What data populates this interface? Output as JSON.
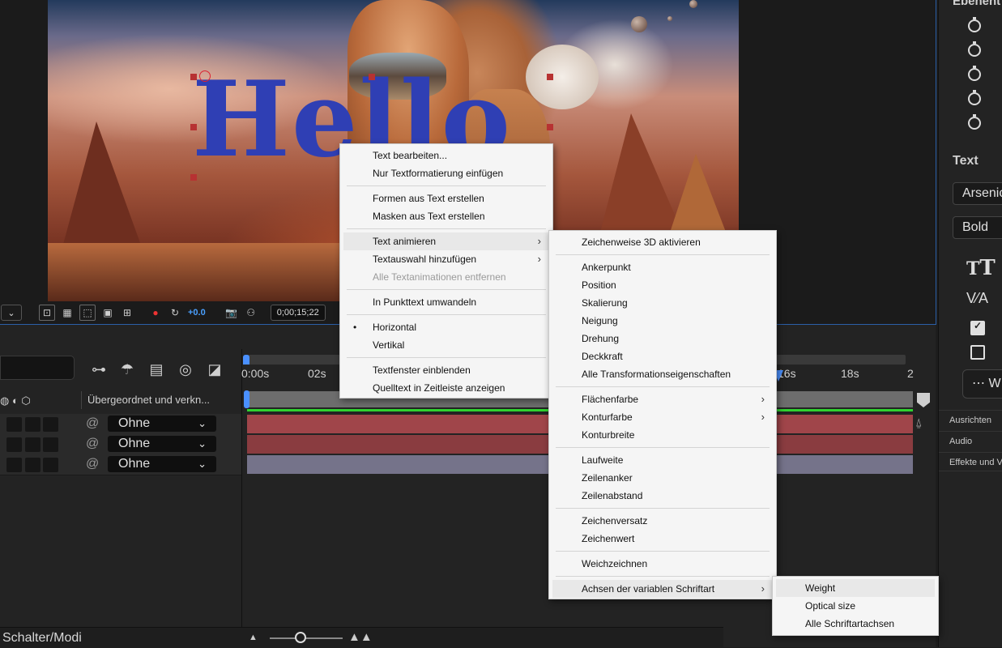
{
  "overlay_text": "Hello",
  "comp_toolbar": {
    "resolution_chevron": "⌄",
    "exposure": "+0.0",
    "timecode": "0;00;15;22"
  },
  "right_panel": {
    "top_label": "Ebenent",
    "text_section": "Text",
    "font_family": "Arsenic",
    "font_style": "Bold",
    "more_button": "⋯ W",
    "tabs": [
      "Ausrichten",
      "Audio",
      "Effekte und Vo"
    ]
  },
  "timeline": {
    "parent_column_header": "Übergeordnet und verkn...",
    "ruler_labels": [
      "0:00s",
      "02s",
      "16s",
      "18s",
      "2"
    ],
    "layers": [
      {
        "parent": "Ohne"
      },
      {
        "parent": "Ohne"
      },
      {
        "parent": "Ohne"
      }
    ],
    "switch_modes": "Schalter/Modi"
  },
  "context_menu": {
    "items": [
      "Text bearbeiten...",
      "Nur Textformatierung einfügen",
      "Formen aus Text erstellen",
      "Masken aus Text erstellen",
      "Text animieren",
      "Textauswahl hinzufügen",
      "Alle Textanimationen entfernen",
      "In Punkttext umwandeln",
      "Horizontal",
      "Vertikal",
      "Textfenster einblenden",
      "Quelltext in Zeitleiste anzeigen"
    ]
  },
  "animate_submenu": {
    "items": [
      "Zeichenweise 3D aktivieren",
      "Ankerpunkt",
      "Position",
      "Skalierung",
      "Neigung",
      "Drehung",
      "Deckkraft",
      "Alle Transformationseigenschaften",
      "Flächenfarbe",
      "Konturfarbe",
      "Konturbreite",
      "Laufweite",
      "Zeilenanker",
      "Zeilenabstand",
      "Zeichenversatz",
      "Zeichenwert",
      "Weichzeichnen",
      "Achsen der variablen Schriftart"
    ]
  },
  "axes_submenu": {
    "items": [
      "Weight",
      "Optical size",
      "Alle Schriftartachsen"
    ]
  },
  "colors": {
    "accent": "#4a90ff",
    "text_fill": "#2f3fb4",
    "layer_bar_red": "#a0454a",
    "layer_bar_gray": "#75738a",
    "menu_bg": "#f5f5f5"
  }
}
